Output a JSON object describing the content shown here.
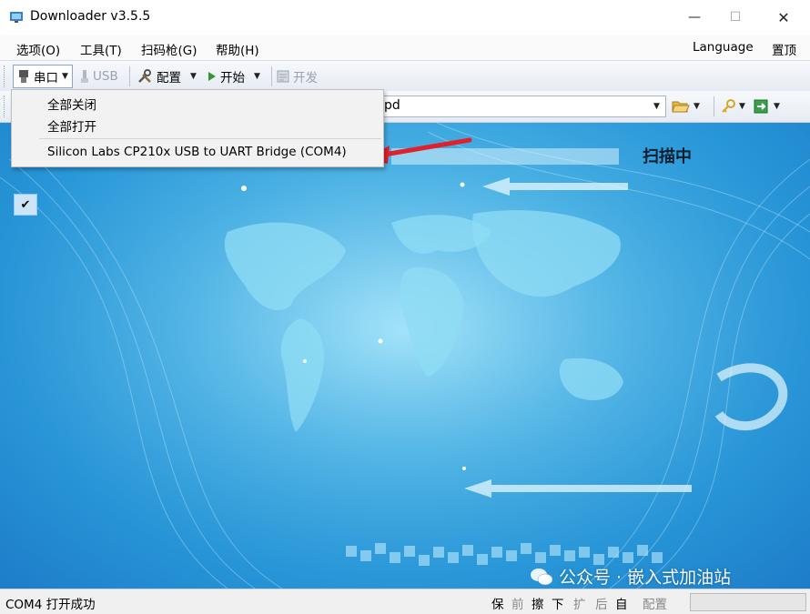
{
  "window": {
    "title": "Downloader v3.5.5",
    "buttons": {
      "minimize": "—",
      "maximize": "☐",
      "close": "✕"
    }
  },
  "menubar": {
    "items": [
      "选项(O)",
      "工具(T)",
      "扫码枪(G)",
      "帮助(H)"
    ],
    "right": [
      "Language",
      "置顶"
    ]
  },
  "toolbar": {
    "serial_label": "串口",
    "usb_label": "USB",
    "config_label": "配置",
    "start_label": "开始",
    "develop_label": "开发"
  },
  "file_combo": {
    "value_suffix": "pd"
  },
  "serial_menu": {
    "items": [
      "全部关闭",
      "全部打开"
    ],
    "port_item": "Silicon Labs CP210x USB to UART Bridge (COM4)"
  },
  "main": {
    "scanning_label": "扫描中"
  },
  "status": {
    "message": "COM4 打开成功",
    "segments": [
      "保",
      "前",
      "擦",
      "下",
      "扩",
      "后",
      "自"
    ],
    "config_label": "配置"
  },
  "watermark": {
    "text": "公众号 · 嵌入式加油站"
  },
  "colors": {
    "accent": "#2796d8",
    "arrow": "#e0202a",
    "check_bg": "#cce4f7"
  },
  "icons": [
    "app-icon",
    "serial-port-icon",
    "usb-icon",
    "config-tools-icon",
    "play-icon",
    "develop-icon",
    "folder-open-icon",
    "key-icon",
    "export-icon",
    "check-icon",
    "wechat-icon"
  ]
}
